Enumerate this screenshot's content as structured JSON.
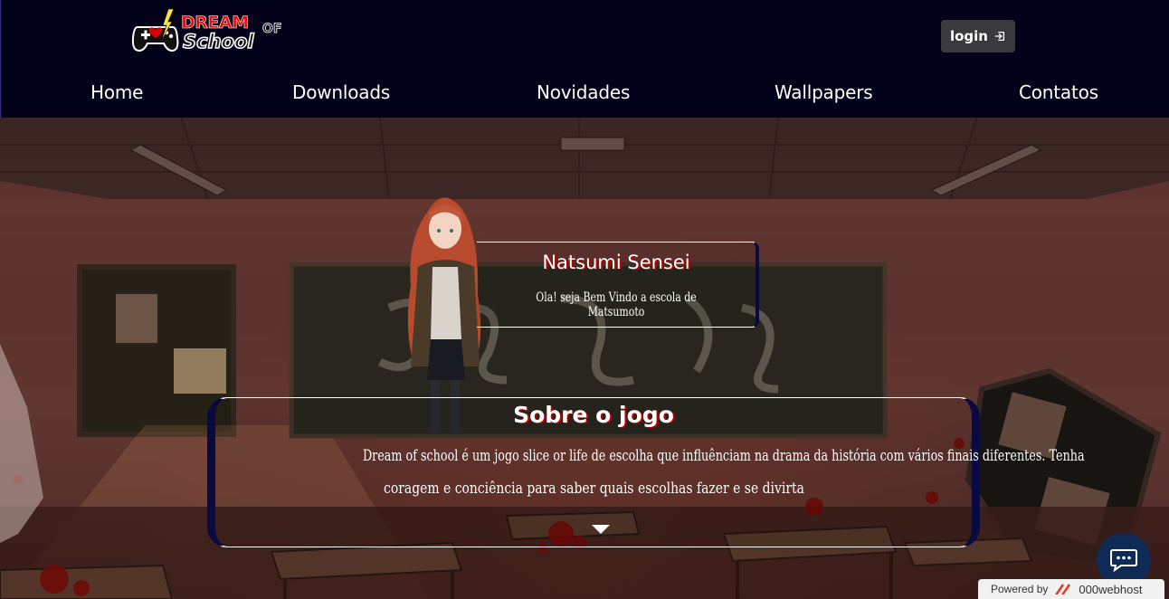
{
  "header": {
    "logo_text_top": "DREAM",
    "logo_text_of": "OF",
    "logo_text_bottom": "School",
    "login_label": "login"
  },
  "nav": {
    "items": [
      {
        "label": "Home"
      },
      {
        "label": "Downloads"
      },
      {
        "label": "Novidades"
      },
      {
        "label": "Wallpapers"
      },
      {
        "label": "Contatos"
      }
    ]
  },
  "natsumi_card": {
    "title": "Natsumi Sensei",
    "text": "Ola! seja Bem Vindo a escola de Matsumoto"
  },
  "sobre_card": {
    "title": "Sobre o jogo",
    "text_line1": "Dream of school é um jogo slice or life de escolha que influênciam na drama da história com vários finais diferentes. Tenha",
    "text_line2": "coragem e conciência para saber quais escolhas fazer e se divirta"
  },
  "footer": {
    "powered_label": "Powered by",
    "host_name": "000webhost"
  },
  "colors": {
    "header_bg": "#04021a",
    "card_border_accent": "#0a0a40",
    "title_shadow": "#bb0000",
    "chat_bg": "#0e2a55"
  }
}
